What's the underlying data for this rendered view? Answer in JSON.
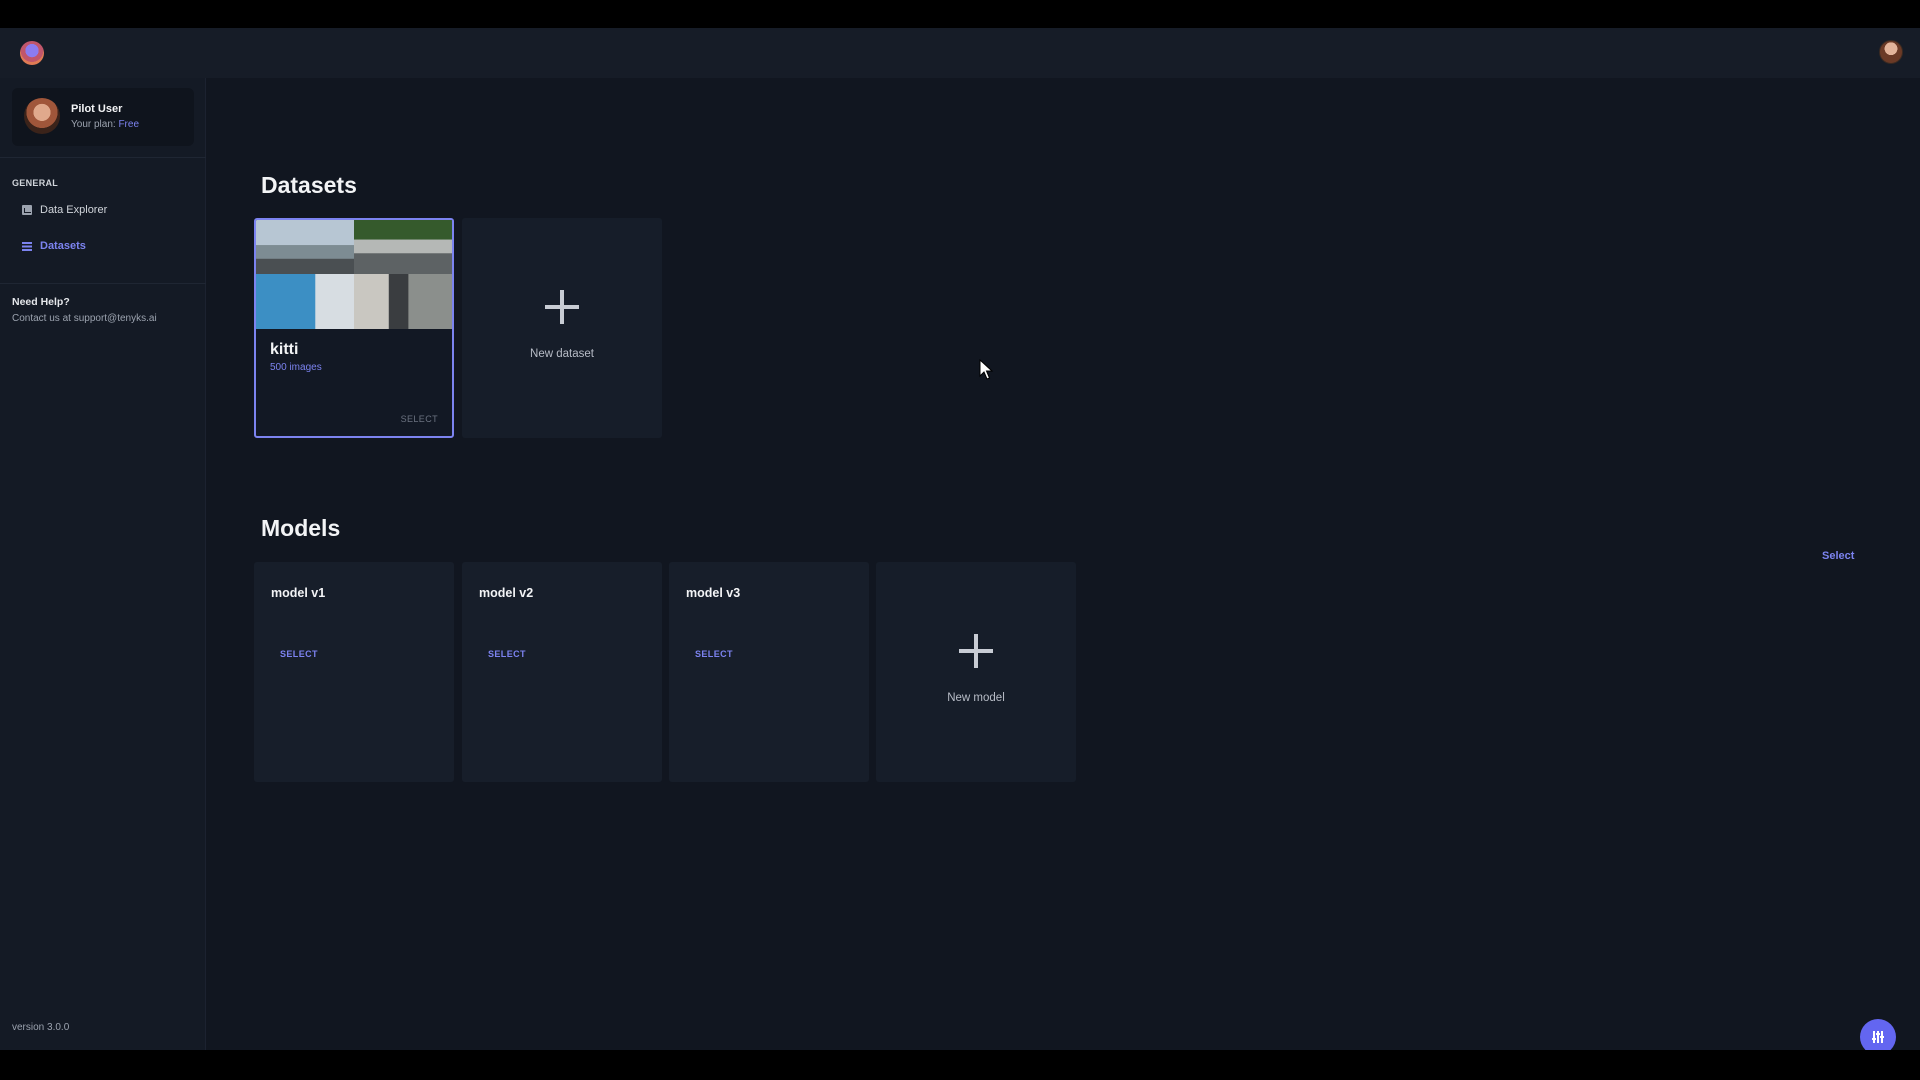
{
  "user": {
    "name": "Pilot User",
    "plan_label": "Your plan:",
    "plan_value": "Free"
  },
  "sidebar": {
    "section": "GENERAL",
    "items": [
      {
        "label": "Data Explorer",
        "icon": "chart-icon",
        "active": false
      },
      {
        "label": "Datasets",
        "icon": "list-icon",
        "active": true
      }
    ],
    "help_title": "Need Help?",
    "help_text": "Contact us at support@tenyks.ai",
    "version": "version 3.0.0"
  },
  "datasets": {
    "title": "Datasets",
    "items": [
      {
        "name": "kitti",
        "count": "500 images",
        "select_label": "SELECT"
      }
    ],
    "new_label": "New dataset"
  },
  "models": {
    "title": "Models",
    "select_link": "Select",
    "items": [
      {
        "name": "model v1",
        "select_label": "SELECT"
      },
      {
        "name": "model v2",
        "select_label": "SELECT"
      },
      {
        "name": "model v3",
        "select_label": "SELECT"
      }
    ],
    "new_label": "New model"
  },
  "colors": {
    "accent": "#7c83f0",
    "background": "#111620",
    "fab": "#6366f1"
  }
}
